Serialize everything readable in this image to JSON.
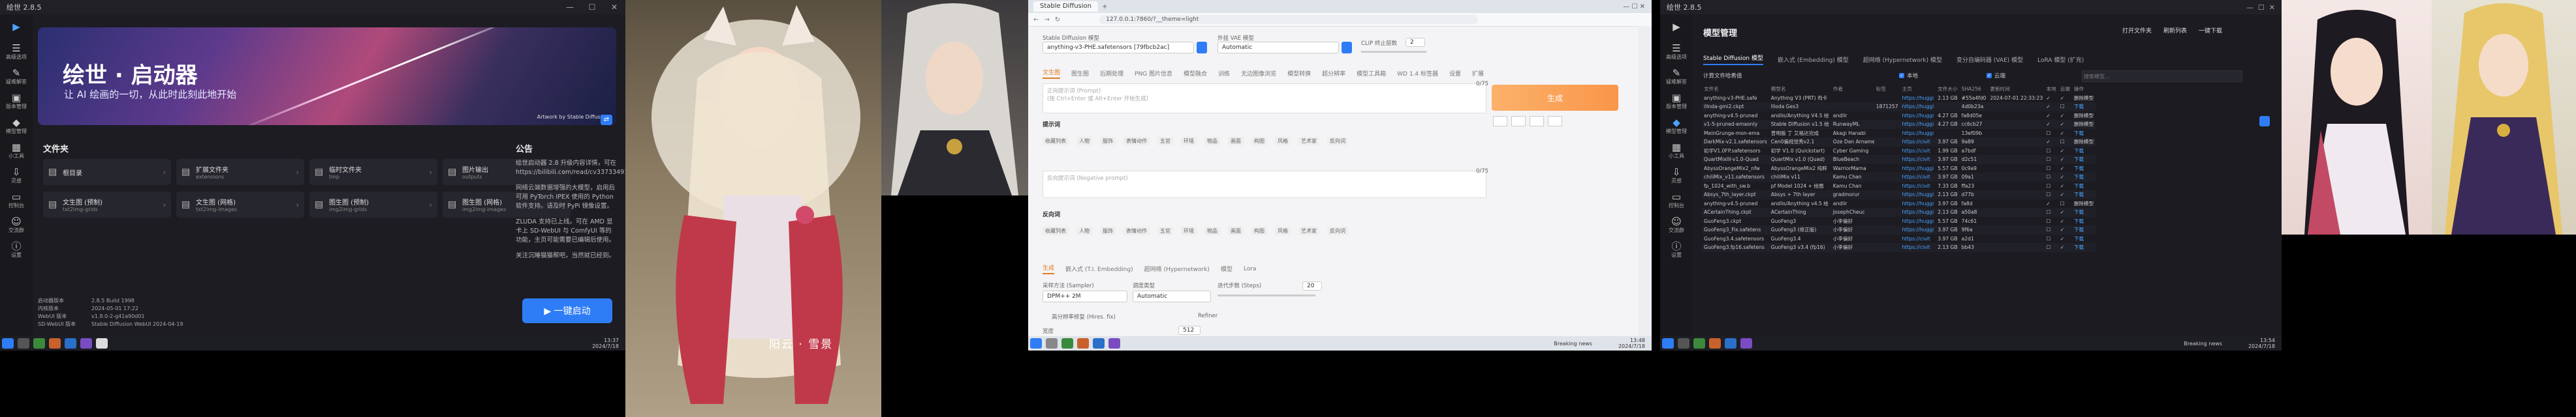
{
  "launcher": {
    "window_title": "绘世 2.8.5",
    "sidebar": [
      {
        "icon": "play-icon",
        "label": ""
      },
      {
        "icon": "sliders-icon",
        "label": "高级选项"
      },
      {
        "icon": "wrench-icon",
        "label": "疑难解答"
      },
      {
        "icon": "box-icon",
        "label": "版本管理"
      },
      {
        "icon": "cube-icon",
        "label": "模型管理"
      },
      {
        "icon": "grid-icon",
        "label": "小工具"
      },
      {
        "icon": "download-icon",
        "label": "灵感"
      },
      {
        "icon": "terminal-icon",
        "label": "控制台"
      },
      {
        "icon": "people-icon",
        "label": "交流群"
      },
      {
        "icon": "info-icon",
        "label": "设置"
      }
    ],
    "banner": {
      "title": "绘世 · 启动器",
      "subtitle": "让 AI 绘画的一切，从此时此刻此地开始",
      "caption": "Artwork by Stable Diffusion"
    },
    "folders_heading": "文件夹",
    "folders": [
      {
        "title": "根目录",
        "sub": ""
      },
      {
        "title": "扩展文件夹",
        "sub": "extensions"
      },
      {
        "title": "临时文件夹",
        "sub": "tmp"
      },
      {
        "title": "图片输出",
        "sub": "outputs"
      },
      {
        "title": "文生图 (预制)",
        "sub": "txt2img-grids"
      },
      {
        "title": "文生图 (网格)",
        "sub": "txt2img-images"
      },
      {
        "title": "图生图 (预制)",
        "sub": "img2img-grids"
      },
      {
        "title": "图生图 (网格)",
        "sub": "img2img-images"
      }
    ],
    "notice_heading": "公告",
    "notice": [
      "绘世启动器 2.8 升级内容详情，可在 https://bilibili.com/read/cv33733491",
      "网络云端数据增强的大模型，启用后可用 PyTorch IPEX 使用的 Python 软件支持。请及时 PyPi 镜像设置。",
      "ZLUDA 支持已上线。可在 AMD 显卡上 SD-WebUI 与 ComfyUI 等的功能，主页可能需要已编辑后使用。",
      "关注沉睡猫猫帮吧，当然就已经到。"
    ],
    "launch_label": "▶ 一键启动",
    "version": [
      {
        "k": "启动器版本",
        "v": "2.8.5 Build 1998"
      },
      {
        "k": "内核版本",
        "v": "2024-05-01 17:22"
      },
      {
        "k": "WebUI 版本",
        "v": "v1.9.0-2-g41a90d01"
      },
      {
        "k": "SD-WebUI 版本",
        "v": "Stable Diffusion WebUI 2024-04-19"
      }
    ],
    "taskbar_time": "13:37",
    "taskbar_date": "2024/7/18"
  },
  "mid_overlay": {
    "text": "阳云 · 雪景"
  },
  "webui": {
    "tab_title": "Stable Diffusion",
    "url": "127.0.0.1:7860/?__theme=light",
    "checkpoint_label": "Stable Diffusion 模型",
    "checkpoint_value": "anything-v3-PHE.safetensors [79fbcb2ac]",
    "vae_label": "外挂 VAE 模型",
    "vae_value": "Automatic",
    "clip_label": "CLIP 终止层数",
    "clip_value": "2",
    "tabs": [
      "文生图",
      "图生图",
      "后期处理",
      "PNG 图片信息",
      "模型融合",
      "训练",
      "无边图像浏览",
      "模型转换",
      "超分辨率",
      "模型工具箱",
      "WD 1.4 标签器",
      "设置",
      "扩展"
    ],
    "prompt_label": "正向提示词 (Prompt)",
    "prompt_hint": "(按 Ctrl+Enter 或 Alt+Enter 开始生成)",
    "neg_label": "反向提示词 (Negative prompt)",
    "generate_label": "生成",
    "prompt_section": "提示词",
    "neg_section": "反向词",
    "count_1": "0/75",
    "count_2": "0/75",
    "tag_tabs": [
      "收藏列表",
      "人物",
      "服饰",
      "表情动作",
      "五官",
      "环境",
      "物品",
      "画面",
      "构图",
      "风格",
      "艺术家",
      "反向词"
    ],
    "bottom_tabs": [
      "生成",
      "嵌入式 (T.I. Embedding)",
      "超网络 (Hypernetwork)",
      "模型",
      "Lora"
    ],
    "sampler_label": "采样方法 (Sampler)",
    "sampler_value": "DPM++ 2M",
    "schedule_label": "调度类型",
    "schedule_value": "Automatic",
    "steps_label": "迭代步数 (Steps)",
    "steps_value": "20",
    "hires_label": "高分辨率修复 (Hires. fix)",
    "refiner_label": "Refiner",
    "width_label": "宽度",
    "width_value": "512",
    "taskbar_news": "Breaking news",
    "taskbar_time": "13:48",
    "taskbar_date": "2024/7/18"
  },
  "models": {
    "window_title": "绘世 2.8.5",
    "heading": "模型管理",
    "top_buttons": [
      "打开文件夹",
      "刷新列表",
      "一键下载"
    ],
    "tabs": [
      "Stable Diffusion 模型",
      "嵌入式 (Embedding) 模型",
      "超网络 (Hypernetwork) 模型",
      "变分自编码器 (VAE) 模型",
      "LoRA 模型 (扩充)"
    ],
    "filter_label": "计算文件哈希值",
    "check_local": "本地",
    "check_cloud": "云端",
    "search_placeholder": "搜索模型...",
    "columns": [
      "文件名",
      "模型名",
      "作者",
      "标签",
      "主页",
      "文件大小",
      "SHA256",
      "更新时间",
      "本地",
      "云端",
      "操作"
    ],
    "rows": [
      [
        "anything-v3-PHE.safe",
        "Anything V3 (PRT) 鸡卡",
        "",
        "",
        "https://huggi",
        "2.13 GB",
        "#55a4fd0",
        "2024-07-01 22:33:23",
        "✓",
        "✓",
        "删除模型"
      ],
      [
        "illnda-gmi2.ckpt",
        "Illoda Ges3",
        "",
        "1871257",
        "https://huggi",
        "",
        "4d0b23a",
        "",
        "✓",
        "☐",
        "下载"
      ],
      [
        "anything-v4.5-pruned",
        "andlis/Anything V4.5 绘",
        "andlir",
        "",
        "https://huggi",
        "4.27 GB",
        "fa8d05e",
        "",
        "✓",
        "✓",
        "删除模型"
      ],
      [
        "v1-5-pruned-emaonly",
        "Stable Diffusion v1.5 绘",
        "RunwayML",
        "",
        "https://huggi",
        "4.27 GB",
        "cc6cb27",
        "",
        "✓",
        "✓",
        "删除模型"
      ],
      [
        "MeinGrunge-mon-ema",
        "曾明版 丁 艾格达完成",
        "Akagi Hanabi",
        "",
        "https://huggi",
        "",
        "13ef09b",
        "",
        "☐",
        "✓",
        "下载"
      ],
      [
        "DarkMix-v2.1.safetensors",
        "Cen0偏视觉秀v2.1",
        "Oze Dan Arname",
        "",
        "https://civit",
        "3.97 GB",
        "9a89",
        "",
        "✓",
        "☐",
        "删除模型"
      ],
      [
        "初学V1.0FP.safetensors",
        "初学 V1.0 (Quickstart)",
        "Cyber Gaming",
        "",
        "https://civit",
        "1.99 GB",
        "a7bdf",
        "",
        "☐",
        "✓",
        "下载"
      ],
      [
        "QuartMixIII-v1.0-Quad",
        "QuartMix v1.0 (Quad)",
        "BlueBeach",
        "",
        "https://civit",
        "3.97 GB",
        "d2c51",
        "",
        "☐",
        "✓",
        "下载"
      ],
      [
        "AbyssOrangeMix2_nfw",
        "AbyssOrangeMix2 纯粹",
        "WarriorMama",
        "",
        "https://huggi",
        "5.57 GB",
        "0c9a9",
        "",
        "☐",
        "✓",
        "下载"
      ],
      [
        "chiliMix_v11.safetensors",
        "chiliMix v11",
        "Kamu Chan",
        "",
        "https://civit",
        "3.97 GB",
        "09a1",
        "",
        "☐",
        "✓",
        "下载"
      ],
      [
        "fp_1024_with_sw.b",
        "pf Model 1024 + 绘图",
        "Kamu Chan",
        "",
        "https://civit",
        "7.33 GB",
        "ffa23",
        "",
        "☐",
        "✓",
        "下载"
      ],
      [
        "Absys_7th_layer.ckpt",
        "Absys + 7th layer",
        "gradmorur",
        "",
        "https://huggi",
        "2.13 GB",
        "d77b",
        "",
        "☐",
        "✓",
        "下载"
      ],
      [
        "anything-v4.5-pruned",
        "andlis/Anything v4.5 绘",
        "andlir",
        "",
        "https://huggi",
        "3.97 GB",
        "fa8d",
        "",
        "✓",
        "☐",
        "删除模型"
      ],
      [
        "ACertainThing.ckpt",
        "ACertainThing",
        "JosephCheuc",
        "",
        "https://huggi",
        "2.13 GB",
        "a50a8",
        "",
        "☐",
        "✓",
        "下载"
      ],
      [
        "GuoFeng3.ckpt",
        "GuoFeng3",
        "小李偏好",
        "",
        "https://huggi",
        "5.57 GB",
        "74c61",
        "",
        "☐",
        "✓",
        "下载"
      ],
      [
        "GuoFeng3_Fix.safetens",
        "GuoFeng3 (修正版)",
        "小李偏好",
        "",
        "https://huggi",
        "3.97 GB",
        "9f6a",
        "",
        "☐",
        "✓",
        "下载"
      ],
      [
        "GuoFeng3.4.safetensors",
        "GuoFeng3.4",
        "小李偏好",
        "",
        "https://civit",
        "3.97 GB",
        "a2d1",
        "",
        "☐",
        "✓",
        "下载"
      ],
      [
        "GuoFeng3.fp16.safetens",
        "GuoFeng3 v3.4 (fp16)",
        "小李偏好",
        "",
        "https://civit",
        "2.13 GB",
        "bb43",
        "",
        "☐",
        "✓",
        "下载"
      ]
    ],
    "taskbar_news": "Breaking news",
    "taskbar_time": "13:54",
    "taskbar_date": "2024/7/18"
  },
  "colors": {
    "accent": "#2f7df6",
    "generate": "#f9964a",
    "tab_active": "#e07b20"
  }
}
